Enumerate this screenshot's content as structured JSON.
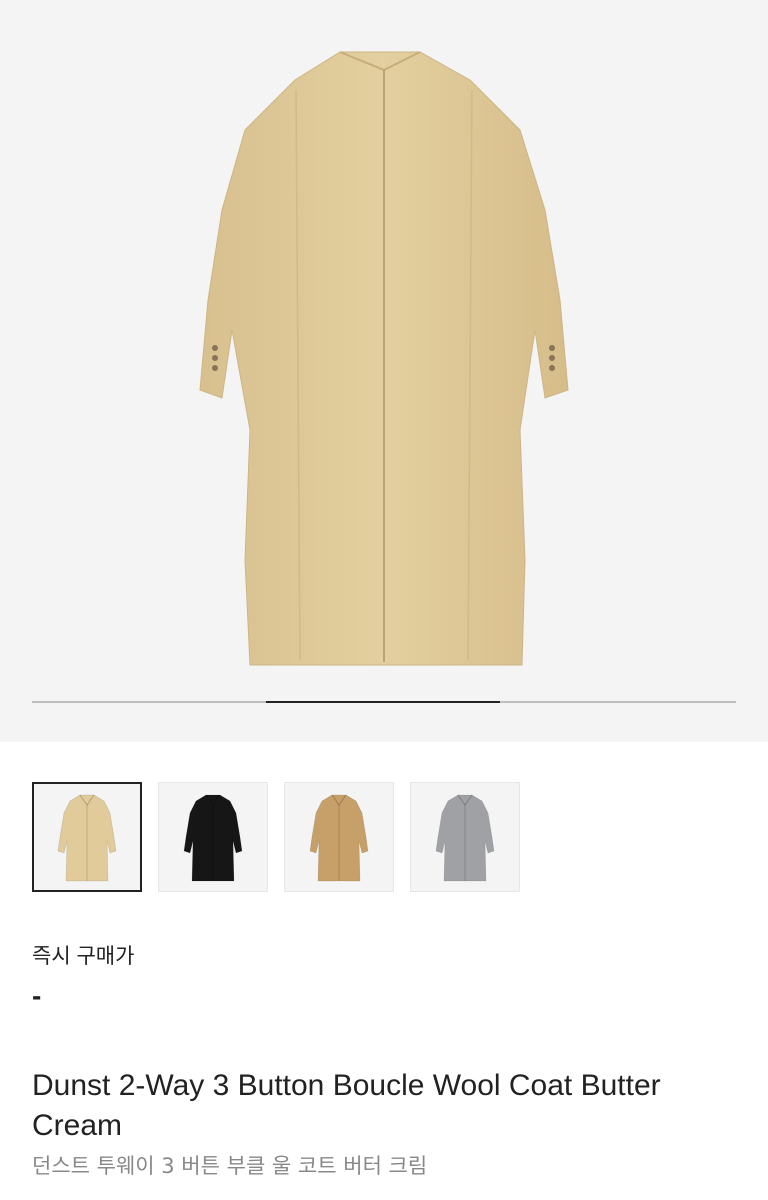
{
  "gallery": {
    "main_image": "coat-back-view",
    "main_color": "#e1cb9b",
    "progress": {
      "position_fraction": 0.333,
      "visible_fraction": 0.333
    },
    "thumbnails": [
      {
        "name": "butter-cream",
        "color": "#e1cb9b",
        "selected": true
      },
      {
        "name": "black",
        "color": "#161616",
        "selected": false
      },
      {
        "name": "camel",
        "color": "#c79f68",
        "selected": false
      },
      {
        "name": "grey",
        "color": "#9fa1a5",
        "selected": false
      }
    ]
  },
  "price": {
    "label": "즉시 구매가",
    "value": "-"
  },
  "product": {
    "title": "Dunst 2-Way 3 Button Boucle Wool Coat Butter Cream",
    "title_ko": "던스트 투웨이 3 버튼 부클 울 코트 버터 크림"
  }
}
